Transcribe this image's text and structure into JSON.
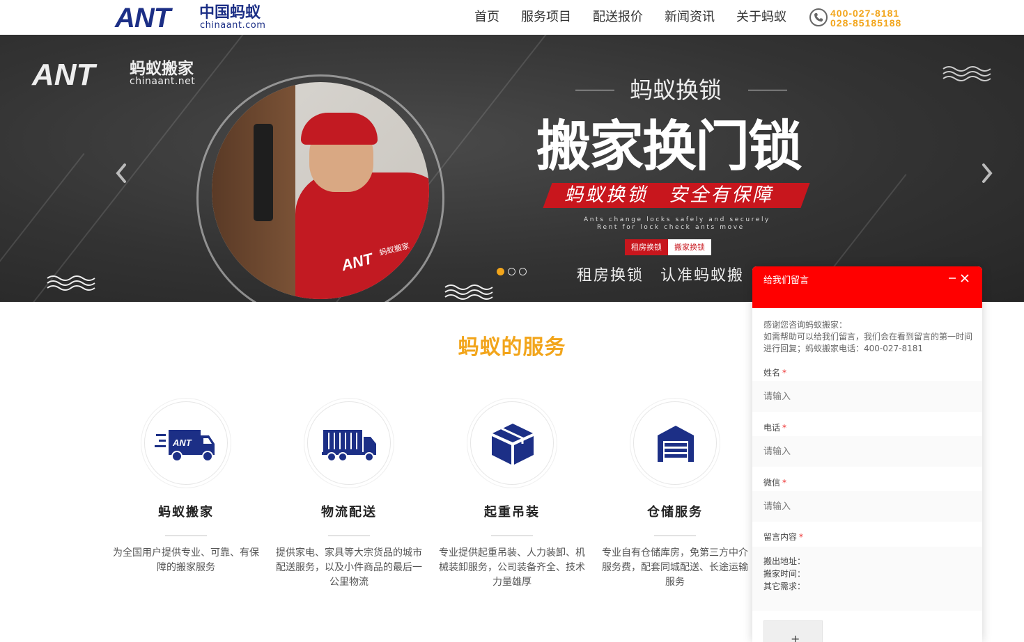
{
  "header": {
    "logo_ant": "ANT",
    "logo_cn": "中国蚂蚁",
    "logo_en": "chinaant.com",
    "nav": [
      "首页",
      "服务项目",
      "配送报价",
      "新闻资讯",
      "关于蚂蚁"
    ],
    "phones": [
      "400-027-8181",
      "028-85185188"
    ]
  },
  "banner": {
    "logo_ant": "ANT",
    "logo_cn": "蚂蚁搬家",
    "logo_en": "chinaant.net",
    "shirt_logo": "ANT",
    "shirt_cn": "蚂蚁搬家",
    "subtitle": "蚂蚁换锁",
    "title": "搬家换门锁",
    "ribbon": "蚂蚁换锁　安全有保障",
    "en_line1": "Ants change locks safely and securely",
    "en_line2": "Rent for lock check ants move",
    "tag1": "租房换锁",
    "tag2": "搬家换锁",
    "bottom": "租房换锁　认准蚂蚁搬",
    "slide_count": 3,
    "active_slide": 1
  },
  "services": {
    "title": "蚂蚁的服务",
    "items": [
      {
        "icon": "moving-truck-icon",
        "name": "蚂蚁搬家",
        "desc": "为全国用户提供专业、可靠、有保障的搬家服务"
      },
      {
        "icon": "cargo-truck-icon",
        "name": "物流配送",
        "desc": "提供家电、家具等大宗货品的城市配送服务，以及小件商品的最后一公里物流"
      },
      {
        "icon": "box-icon",
        "name": "起重吊装",
        "desc": "专业提供起重吊装、人力装卸、机械装卸服务，公司装备齐全、技术力量雄厚"
      },
      {
        "icon": "warehouse-icon",
        "name": "仓储服务",
        "desc": "专业自有仓储库房，免第三方中介服务费，配套同城配送、长途运输服务"
      }
    ]
  },
  "message_panel": {
    "title": "给我们留言",
    "intro": "感谢您咨询蚂蚁搬家：\n如需帮助可以给我们留言，我们会在看到留言的第一时间进行回复；蚂蚁搬家电话：400-027-8181",
    "fields": [
      {
        "label": "姓名",
        "placeholder": "请输入"
      },
      {
        "label": "电话",
        "placeholder": "请输入"
      },
      {
        "label": "微信",
        "placeholder": "请输入"
      }
    ],
    "message_label": "留言内容",
    "message_value": "搬出地址：\n搬家时间：\n其它需求：",
    "required_mark": "*",
    "upload_glyph": "+"
  },
  "colors": {
    "brand_blue": "#1c2f86",
    "accent_orange": "#f2a51b",
    "panel_red": "#ff0000"
  }
}
